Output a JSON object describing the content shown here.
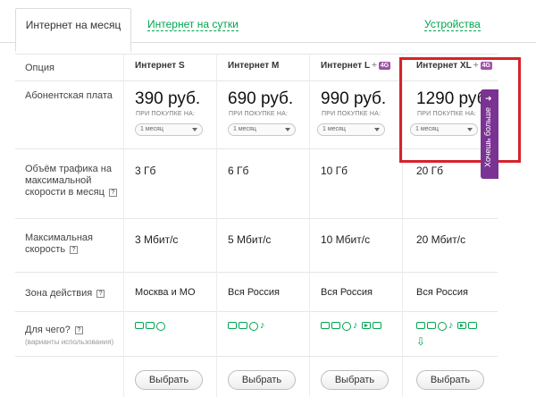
{
  "tabs": [
    {
      "label": "Интернет на месяц",
      "active": true
    },
    {
      "label": "Интернет на сутки",
      "active": false
    },
    {
      "label": "Устройства",
      "active": false
    }
  ],
  "table": {
    "option_header": "Опция",
    "plans": [
      {
        "name": "Интернет S",
        "badge": "",
        "price": "390 руб.",
        "buy_label": "ПРИ ПОКУПКЕ НА:",
        "period": "1 месяц",
        "traffic": "3 Гб",
        "speed": "3 Мбит/с",
        "zone": "Москва и МО",
        "button": "Выбрать"
      },
      {
        "name": "Интернет M",
        "badge": "",
        "price": "690 руб.",
        "buy_label": "ПРИ ПОКУПКЕ НА:",
        "period": "1 месяц",
        "traffic": "6 Гб",
        "speed": "5 Мбит/с",
        "zone": "Вся Россия",
        "button": "Выбрать"
      },
      {
        "name": "Интернет L",
        "badge": "4G",
        "price": "990 руб.",
        "buy_label": "ПРИ ПОКУПКЕ НА:",
        "period": "1 месяц",
        "traffic": "10 Гб",
        "speed": "10 Мбит/с",
        "zone": "Вся Россия",
        "button": "Выбрать"
      },
      {
        "name": "Интернет XL",
        "badge": "4G",
        "price": "1290 руб",
        "buy_label": "ПРИ ПОКУПКЕ НА:",
        "period": "1 месяц",
        "traffic": "20 Гб",
        "speed": "20 Мбит/с",
        "zone": "Вся Россия",
        "button": "Выбрать"
      }
    ],
    "rows": {
      "fee": "Абонентская плата",
      "traffic": "Объём трафика на максимальной скорости в месяц",
      "speed": "Максимальная скорость",
      "zone": "Зона действия",
      "usage": "Для чего?",
      "usage_sub": "(варианты использования)"
    },
    "help_glyph": "?",
    "plus_glyph": "+"
  },
  "side_tab": {
    "label": "Хочешь больше",
    "arrow": "➜"
  },
  "colors": {
    "accent_green": "#00a650",
    "badge_purple": "#a050a8",
    "side_tab_purple": "#7a3392",
    "highlight_red": "#d6232a"
  }
}
